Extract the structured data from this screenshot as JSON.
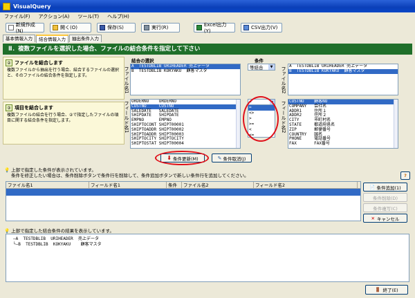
{
  "window": {
    "title": "VisualQuery"
  },
  "menu": [
    "ファイル(F)",
    "アクション(A)",
    "ツール(T)",
    "ヘルプ(H)"
  ],
  "toolbar": {
    "new": "新規作成(N)",
    "open": "開く(O)",
    "save": "保存(S)",
    "run": "実行(R)",
    "excel": "Excel出力(Y)",
    "csv": "CSV出力(V)"
  },
  "tabs": [
    "基本情報入力",
    "結合情報入力",
    "抽出条件入力"
  ],
  "header": "Ⅱ．複数ファイルを選択した場合、ファイルの結合条件を指定して下さい",
  "step1": {
    "title": "ファイルを結合します",
    "desc": "複数ファイルから抽出を行う場合、結合するファイルの選択と、そのファイルの結合条件を指定します。"
  },
  "step2": {
    "title": "項目を結合します",
    "desc": "複数ファイルの結合を行う場合、②で指定したファイルの項目に関する結合条件を指定します。"
  },
  "vlabels": {
    "file1": "ファイル名1",
    "field1": "フィールド名1",
    "file2": "ファイル名2",
    "field2": "フィールド名2"
  },
  "join_select_label": "結合の選択",
  "condition_label": "条件",
  "condition_value": "等結合",
  "file_list1": [
    {
      "k": "A",
      "lib": "TESTDBLIB",
      "file": "URIHEADER",
      "desc": "売上データ"
    },
    {
      "k": "B",
      "lib": "TESTDBLIB",
      "file": "KOKYAKU",
      "desc": "顧客マスタ"
    }
  ],
  "file_list2": [
    {
      "k": "A",
      "lib": "TESTDBLIB",
      "file": "URIHEADER",
      "desc": "売上データ"
    },
    {
      "k": "B",
      "lib": "TESTDBLIB",
      "file": "KOKYAKU",
      "desc": "顧客マスタ"
    }
  ],
  "field_list1": [
    [
      "ORDERNO",
      "ORDERNO"
    ],
    [
      "CUSTNO",
      "CUSTNO"
    ],
    [
      "SALEDATE",
      "SALEDATE"
    ],
    [
      "SHIPDATE",
      "SHIPDATE"
    ],
    [
      "EMPNO",
      "EMPNO"
    ],
    [
      "SHIPTOCONT",
      "SHIPT00001"
    ],
    [
      "SHIPTOADDR",
      "SHIPT00002"
    ],
    [
      "SHIPTOADDR",
      "SHIPT00003"
    ],
    [
      "SHIPTOCITY",
      "SHIPTOCITY"
    ],
    [
      "SHIPTOSTAT",
      "SHIPT00004"
    ]
  ],
  "operator_list": [
    "=",
    "<>",
    ">",
    ">=",
    "<",
    "<="
  ],
  "field_list2": [
    [
      "CUSTNO",
      "顧客NO"
    ],
    [
      "COMPANY",
      "会社名"
    ],
    [
      "ADDR1",
      "住所１"
    ],
    [
      "ADDR2",
      "住所２"
    ],
    [
      "CITY",
      "市町村名"
    ],
    [
      "STATE",
      "都道府県名"
    ],
    [
      "ZIP",
      "郵便番号"
    ],
    [
      "COUNTRY",
      "国名"
    ],
    [
      "PHONE",
      "電話番号"
    ],
    [
      "FAX",
      "FAX番号"
    ]
  ],
  "update_button": "条件更新(M)",
  "cancel_cond_button": "条件取消(J)",
  "info1": {
    "line1": "上部で指定した条件が表示されています。",
    "line2": "条件を修正したい場合は、条件削除ボタンで条件行を削除して、条件追加ボタンで新しい条件行を追加してください。"
  },
  "grid_columns": [
    "ファイル名1",
    "フィールド名1",
    "条件",
    "ファイル名2",
    "フィールド名2"
  ],
  "side_buttons": {
    "add": "条件追加(1)",
    "delete": "条件削除(D)",
    "copy": "条件複写(C)",
    "cancel": "キャンセル"
  },
  "info2": "上部で指定した結合条件の結果を表示しています。",
  "tree": [
    {
      "k": "A",
      "lib": "TESTDBLIB",
      "file": "URIHEADER",
      "desc": "売上データ"
    },
    {
      "k": "B",
      "lib": "TESTDBLIB",
      "file": "KOKYAKU",
      "desc": "顧客マスタ"
    }
  ],
  "exit_button": "終了(E)",
  "help_icon": "?",
  "colors": {
    "header_green": "#1f6f2a",
    "selection": "#316ac5",
    "highlight": "#e0101a"
  }
}
